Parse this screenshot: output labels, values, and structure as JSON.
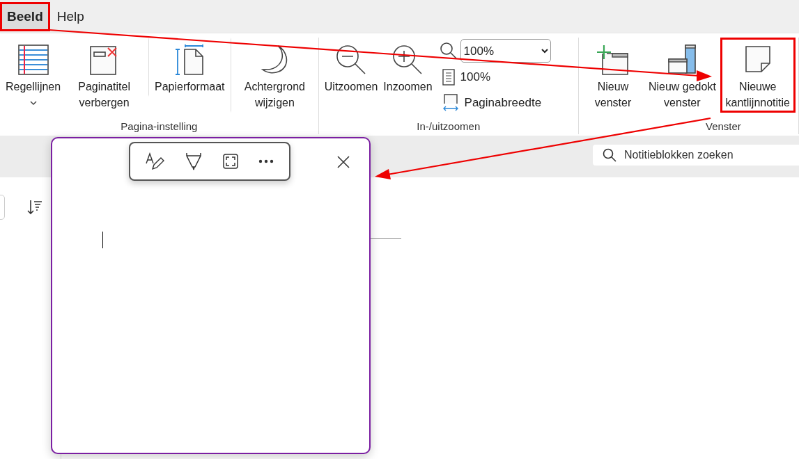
{
  "menu": [
    {
      "label": "Beeld",
      "selected": true,
      "highlighted": true
    },
    {
      "label": "Help",
      "selected": false,
      "highlighted": false
    }
  ],
  "ribbon": {
    "groups": [
      {
        "label": "Pagina-instelling",
        "items": [
          {
            "kind": "large",
            "label": "Regellijnen",
            "dropdown": true,
            "highlighted": false
          },
          {
            "kind": "large",
            "label": "Paginatitel verbergen",
            "dropdown": false,
            "highlighted": false
          },
          {
            "kind": "large",
            "label": "Papierformaat",
            "dropdown": false,
            "highlighted": false
          },
          {
            "kind": "large",
            "label": "Achtergrond wijzigen",
            "dropdown": false,
            "highlighted": false
          }
        ]
      },
      {
        "label": "In-/uitzoomen",
        "items": [
          {
            "kind": "large",
            "label": "Uitzoomen",
            "dropdown": false,
            "highlighted": false
          },
          {
            "kind": "large",
            "label": "Inzoomen",
            "dropdown": false,
            "highlighted": false
          },
          {
            "kind": "select",
            "value": "100%"
          },
          {
            "kind": "small",
            "label": "100%"
          },
          {
            "kind": "small",
            "label": "Paginabreedte"
          }
        ]
      },
      {
        "label": "Venster",
        "items": [
          {
            "kind": "large",
            "label": "Nieuw venster",
            "dropdown": false,
            "highlighted": false
          },
          {
            "kind": "large",
            "label": "Nieuw gedokt venster",
            "dropdown": false,
            "highlighted": false
          },
          {
            "kind": "large",
            "label": "Nieuwe kantlijnnotitie",
            "dropdown": false,
            "highlighted": true
          }
        ]
      }
    ]
  },
  "search": {
    "placeholder": "Notitieblokken zoeken"
  },
  "note_window": {
    "open": true
  }
}
